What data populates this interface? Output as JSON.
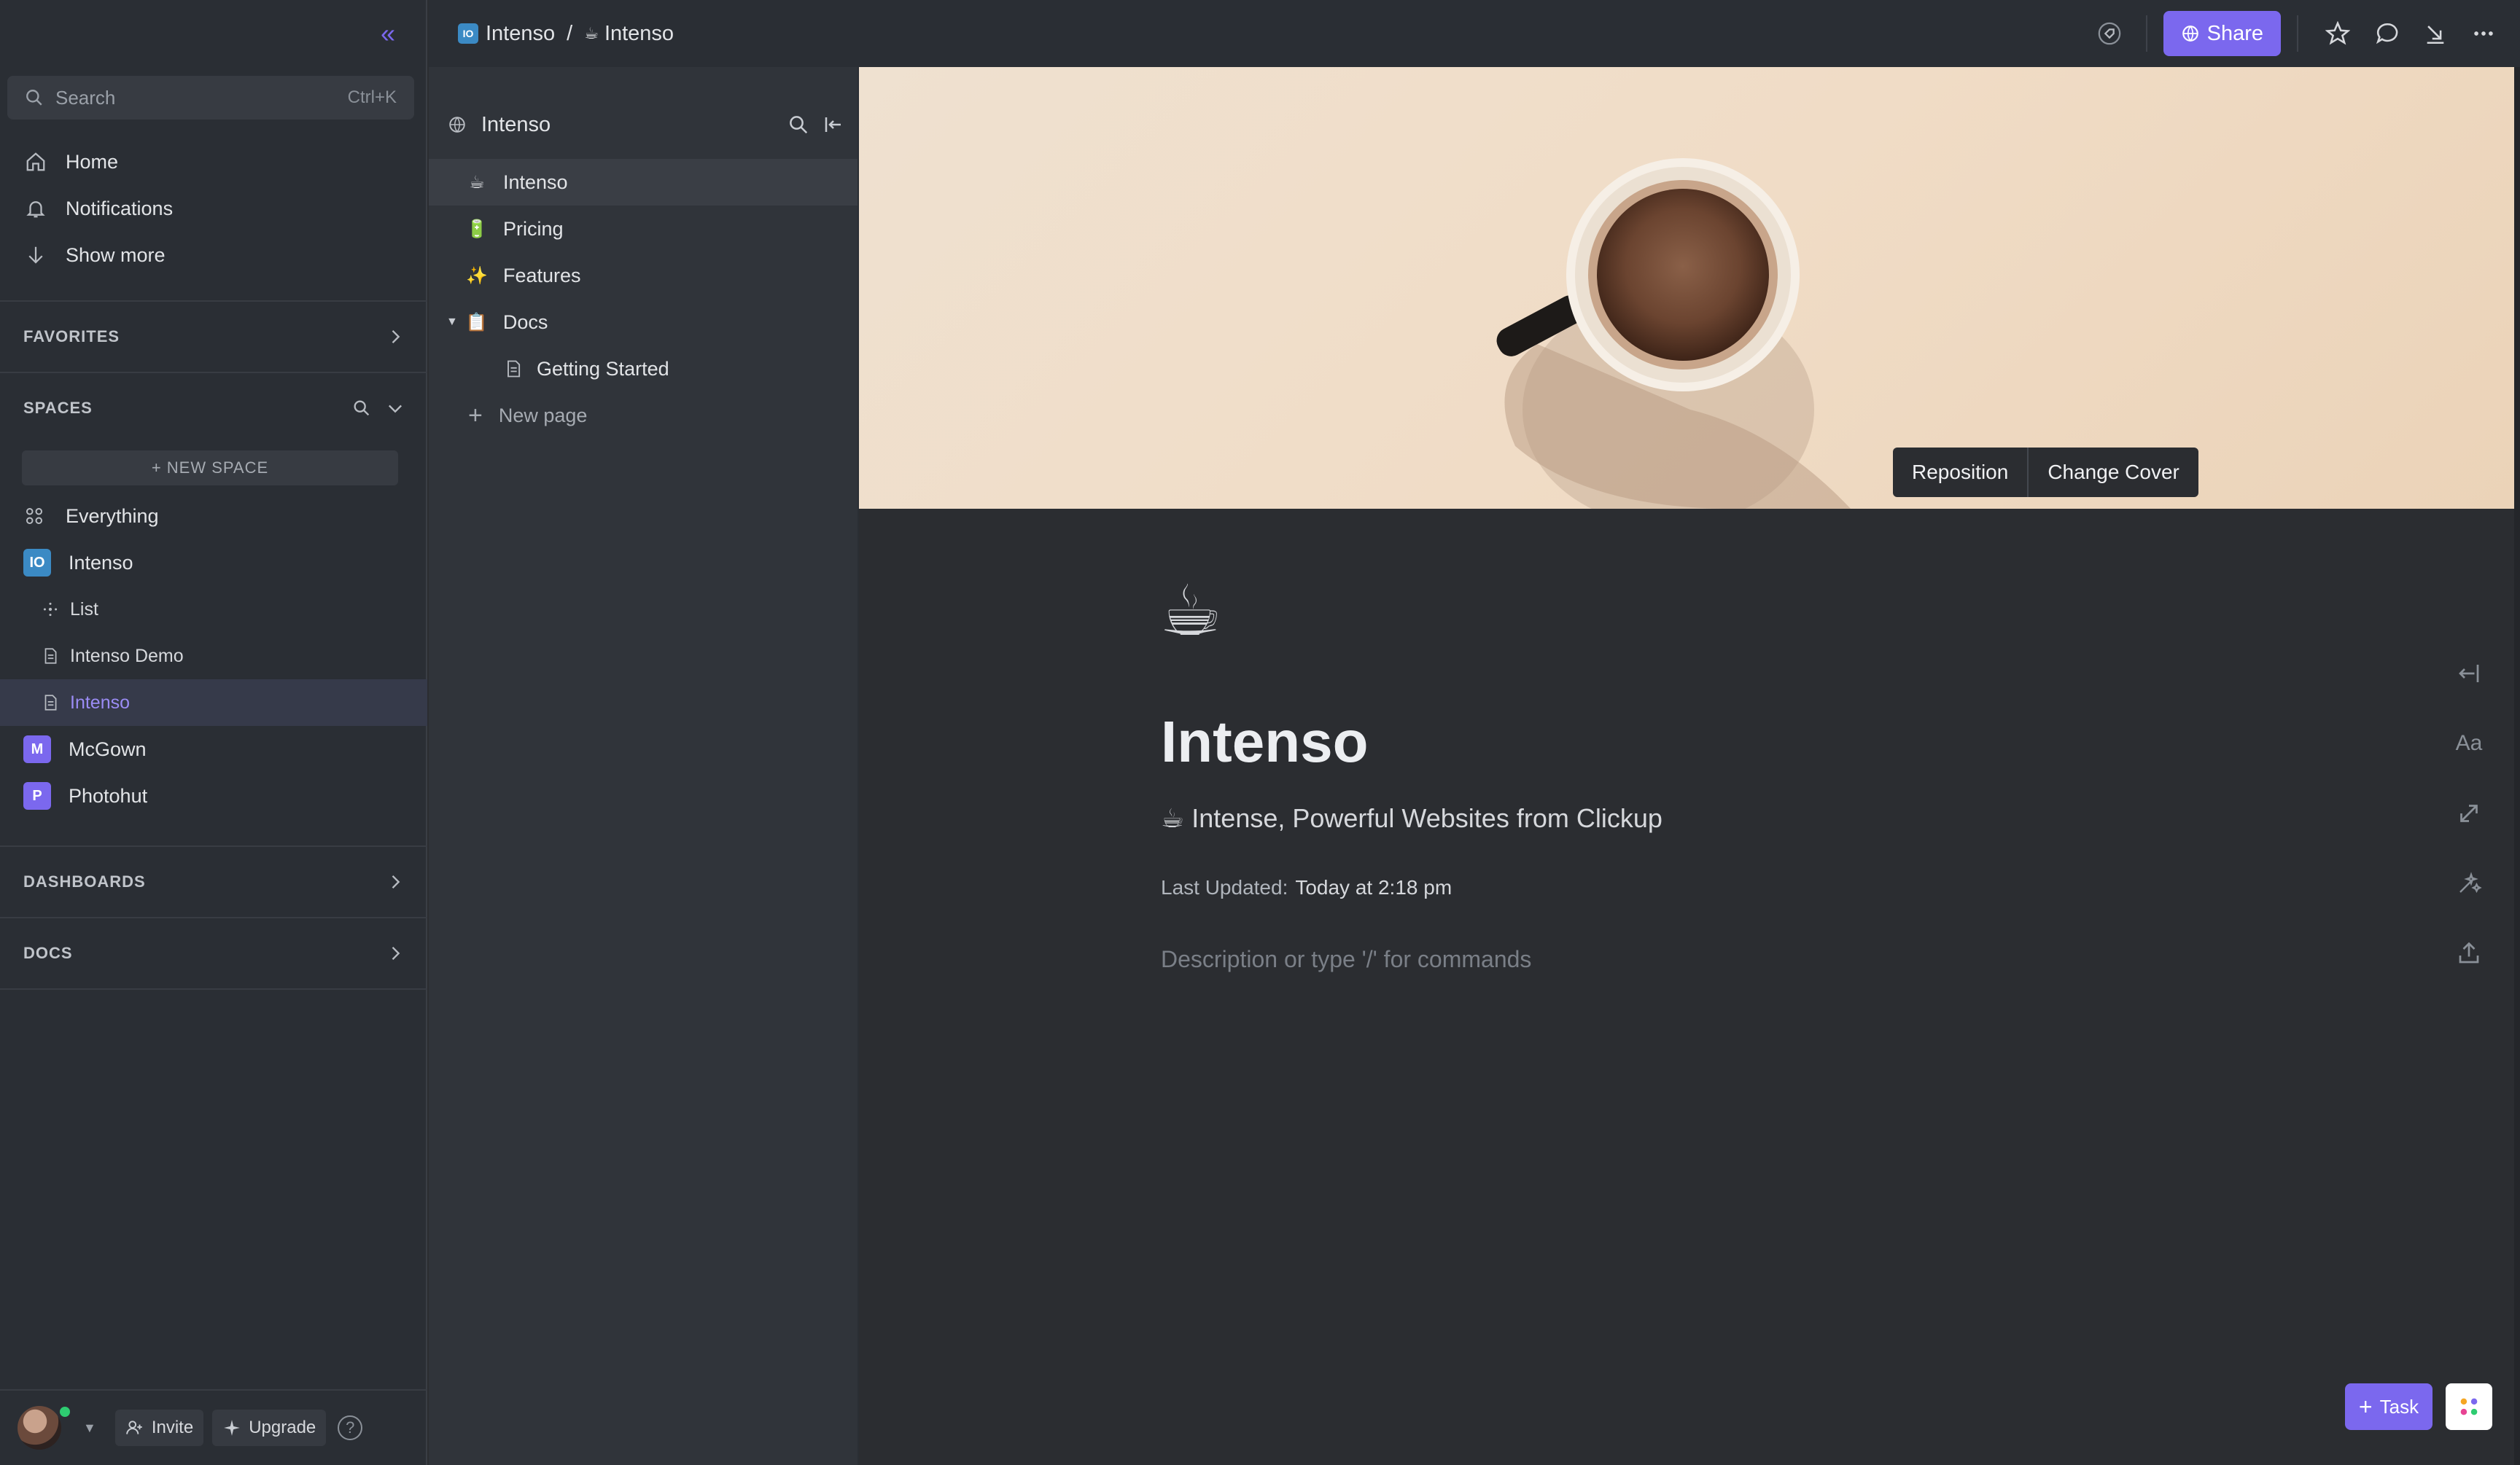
{
  "sidebar": {
    "search": {
      "placeholder": "Search",
      "shortcut": "Ctrl+K"
    },
    "nav": [
      {
        "label": "Home",
        "icon": "home-icon"
      },
      {
        "label": "Notifications",
        "icon": "bell-icon"
      },
      {
        "label": "Show more",
        "icon": "arrow-down-icon"
      }
    ],
    "favorites_label": "FAVORITES",
    "spaces_label": "SPACES",
    "new_space_label": "+ NEW SPACE",
    "spaces": {
      "everything": "Everything",
      "intenso": {
        "badge": "IO",
        "label": "Intenso",
        "color": "#3b8ac4"
      },
      "children": [
        {
          "label": "List"
        },
        {
          "label": "Intenso Demo"
        },
        {
          "label": "Intenso"
        }
      ],
      "mcgown": {
        "badge": "M",
        "label": "McGown",
        "color": "#7b68ee"
      },
      "photohut": {
        "badge": "P",
        "label": "Photohut",
        "color": "#7b68ee"
      }
    },
    "dashboards_label": "DASHBOARDS",
    "docs_label": "DOCS",
    "bottom": {
      "invite": "Invite",
      "upgrade": "Upgrade",
      "help": "?"
    }
  },
  "topbar": {
    "breadcrumb": {
      "space_badge": "IO",
      "space": "Intenso",
      "sep": "/",
      "page_emoji": "☕",
      "page": "Intenso"
    },
    "share_label": "Share"
  },
  "tree": {
    "title": "Intenso",
    "items": [
      {
        "emoji": "☕",
        "label": "Intenso"
      },
      {
        "emoji": "🔋",
        "label": "Pricing"
      },
      {
        "emoji": "✨",
        "label": "Features"
      },
      {
        "emoji": "📋",
        "label": "Docs"
      },
      {
        "label": "Getting Started"
      }
    ],
    "new_page": "New page"
  },
  "doc": {
    "cover_buttons": {
      "reposition": "Reposition",
      "change_cover": "Change Cover"
    },
    "icon": "☕",
    "title": "Intenso",
    "subtitle": "☕ Intense, Powerful Websites from Clickup",
    "meta_label": "Last Updated:",
    "meta_value": "Today at 2:18 pm",
    "description_placeholder": "Description or type '/' for commands"
  },
  "rail": {
    "font_label": "Aa"
  },
  "floating": {
    "task_label": "Task"
  },
  "colors": {
    "accent": "#7b68ee",
    "sidebar_bg": "#2a2e34",
    "main_bg": "#2b2d31"
  }
}
